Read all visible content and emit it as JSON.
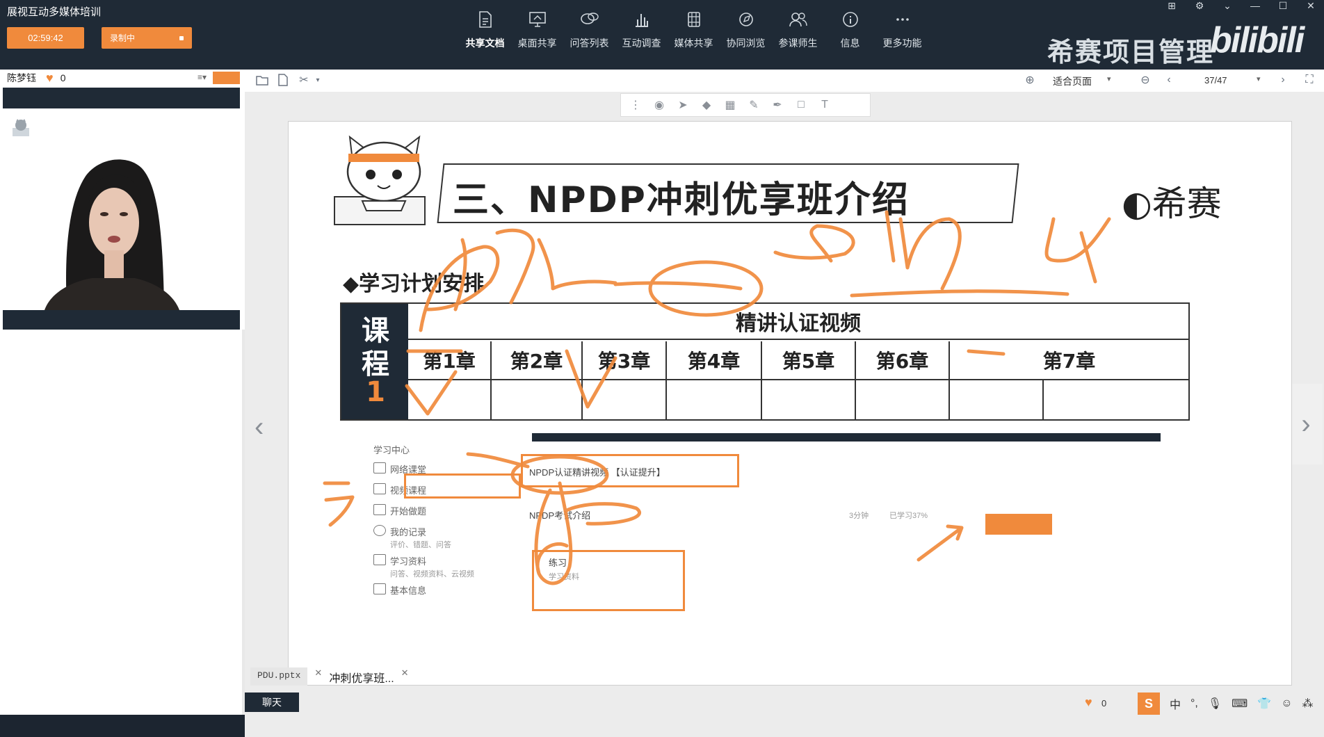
{
  "app": {
    "title": "展视互动多媒体培训",
    "timer": "02:59:42",
    "record_label": "录制中"
  },
  "toolbar": {
    "items": [
      {
        "label": "共享文档",
        "icon": "document-icon"
      },
      {
        "label": "桌面共享",
        "icon": "desktop-share-icon"
      },
      {
        "label": "问答列表",
        "icon": "qa-icon"
      },
      {
        "label": "互动调查",
        "icon": "survey-icon"
      },
      {
        "label": "媒体共享",
        "icon": "media-icon"
      },
      {
        "label": "协同浏览",
        "icon": "browse-icon"
      },
      {
        "label": "参课师生",
        "icon": "users-icon"
      },
      {
        "label": "信息",
        "icon": "info-icon"
      },
      {
        "label": "更多功能",
        "icon": "more-icon"
      }
    ]
  },
  "overlay": {
    "watermark": "希赛项目管理",
    "bili": "bilibili"
  },
  "left_panel": {
    "user_name": "陈梦钰",
    "like_count": "0"
  },
  "doc_toolbar": {
    "fit_page": "适合页面",
    "page": "37/47"
  },
  "slide": {
    "title": "三、NPDP冲刺优享班介绍",
    "logo": "希赛",
    "study_plan": "◆学习计划安排",
    "course_chars": [
      "课",
      "程",
      "1"
    ],
    "header": "精讲认证视频",
    "chapters": [
      "第1章",
      "第2章",
      "第3章",
      "第4章",
      "第5章",
      "第6章",
      "第7章"
    ],
    "embedded": {
      "section": "学习中心",
      "menu": [
        "网络课堂",
        "视频课程",
        "开始做题",
        "我的记录",
        "学习资料",
        "基本信息"
      ],
      "menu_sub": [
        "评价、错题、问答",
        "问答、视频资料、云视频"
      ],
      "course_item": "NPDP认证精讲视频 【认证提升】",
      "intro_item": "NPDP考试介绍",
      "duration": "3分钟",
      "learned": "已学习37%",
      "practice": "练习",
      "practice_sub": "学习资料"
    }
  },
  "bottom": {
    "file_name": "PDU.pptx",
    "file_tab2": "冲刺优享班...",
    "chat": "聊天",
    "like_count": "0",
    "ime": "中"
  },
  "colors": {
    "accent": "#f08a3c",
    "dark": "#1f2a36"
  }
}
